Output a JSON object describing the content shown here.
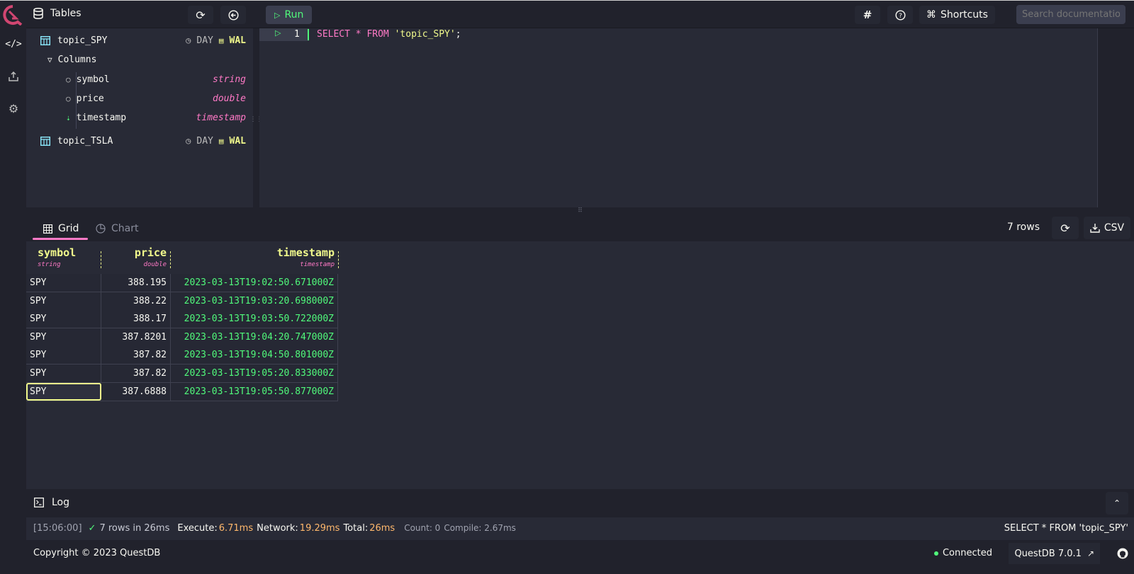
{
  "colors": {
    "accent": "#ff79c6",
    "green": "#50fa7b",
    "yellow": "#f1fa8c",
    "orange": "#ffb86c",
    "cyan": "#8be9fd",
    "bg": "#282a36"
  },
  "rail": {
    "items": [
      {
        "icon": "code-icon",
        "glyph": "</>"
      },
      {
        "icon": "upload-icon",
        "glyph": "⇪"
      },
      {
        "icon": "gear-icon",
        "glyph": "⚙"
      }
    ]
  },
  "topbar": {
    "tables_label": "Tables",
    "run_label": "Run",
    "shortcuts_label": "Shortcuts",
    "search_placeholder": "Search documentation"
  },
  "schema": {
    "tables": [
      {
        "name": "topic_SPY",
        "partition": "DAY",
        "wal": "WAL",
        "expanded": true,
        "columns_label": "Columns",
        "columns": [
          {
            "name": "symbol",
            "type": "string",
            "designated": false
          },
          {
            "name": "price",
            "type": "double",
            "designated": false
          },
          {
            "name": "timestamp",
            "type": "timestamp",
            "designated": true
          }
        ]
      },
      {
        "name": "topic_TSLA",
        "partition": "DAY",
        "wal": "WAL",
        "expanded": false
      }
    ]
  },
  "editor": {
    "line_number": "1",
    "tokens": {
      "select": "SELECT",
      "star": " * ",
      "from": "FROM",
      "space": " ",
      "table": "'topic_SPY'",
      "semicolon": ";"
    }
  },
  "results": {
    "tabs": [
      {
        "label": "Grid",
        "active": true
      },
      {
        "label": "Chart",
        "active": false
      }
    ],
    "row_count": "7 rows",
    "csv_label": "CSV",
    "columns": [
      {
        "name": "symbol",
        "type": "string"
      },
      {
        "name": "price",
        "type": "double"
      },
      {
        "name": "timestamp",
        "type": "timestamp"
      }
    ],
    "rows": [
      [
        "SPY",
        "388.195",
        "2023-03-13T19:02:50.671000Z"
      ],
      [
        "SPY",
        "388.22",
        "2023-03-13T19:03:20.698000Z"
      ],
      [
        "SPY",
        "388.17",
        "2023-03-13T19:03:50.722000Z"
      ],
      [
        "SPY",
        "387.8201",
        "2023-03-13T19:04:20.747000Z"
      ],
      [
        "SPY",
        "387.82",
        "2023-03-13T19:04:50.801000Z"
      ],
      [
        "SPY",
        "387.82",
        "2023-03-13T19:05:20.833000Z"
      ],
      [
        "SPY",
        "387.6888",
        "2023-03-13T19:05:50.877000Z"
      ]
    ],
    "active_row": 6,
    "active_col": 0
  },
  "log": {
    "title": "Log",
    "time": "[15:06:00]",
    "summary": "7 rows in 26ms",
    "execute_label": "Execute:",
    "execute_value": "6.71ms",
    "network_label": "Network:",
    "network_value": "19.29ms",
    "total_label": "Total:",
    "total_value": "26ms",
    "count": "Count: 0",
    "compile": "Compile: 2.67ms",
    "query": "SELECT * FROM 'topic_SPY'"
  },
  "footer": {
    "copyright": "Copyright © 2023 QuestDB",
    "status": "Connected",
    "version": "QuestDB 7.0.1"
  }
}
